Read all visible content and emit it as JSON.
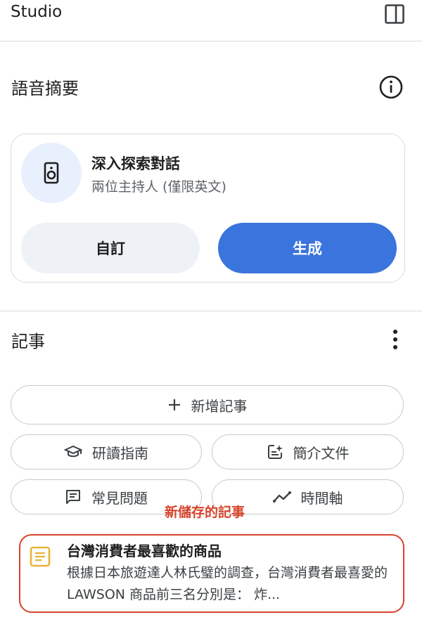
{
  "header": {
    "title": "Studio",
    "panel_icon": "side-panel-icon"
  },
  "audio_overview": {
    "title": "語音摘要",
    "info_icon": "info-icon",
    "card": {
      "icon": "speaker-icon",
      "title": "深入探索對話",
      "subtitle": "兩位主持人 (僅限英文)",
      "custom_label": "自訂",
      "generate_label": "生成"
    }
  },
  "notes": {
    "title": "記事",
    "more_icon": "more-vert-icon",
    "add_label": "新增記事",
    "buttons": [
      {
        "label": "研讀指南",
        "icon": "school-icon"
      },
      {
        "label": "簡介文件",
        "icon": "document-sparkle-icon"
      },
      {
        "label": "常見問題",
        "icon": "faq-list-icon"
      },
      {
        "label": "時間軸",
        "icon": "timeline-icon"
      }
    ],
    "annotation": "新儲存的記事",
    "saved_note": {
      "icon": "note-icon",
      "title": "台灣消費者最喜歡的商品",
      "preview": "根據日本旅遊達人林氏璧的調查，台灣消費者最喜愛的 LAWSON 商品前三名分別是： 炸..."
    }
  },
  "colors": {
    "primary": "#3a74dd",
    "annotation": "#d6442b",
    "note_icon": "#e8b43a"
  }
}
